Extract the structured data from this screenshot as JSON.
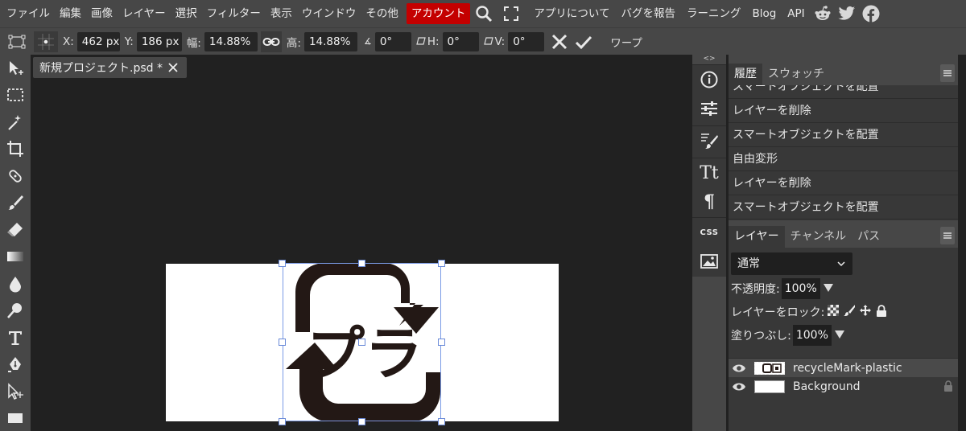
{
  "menubar": {
    "items": [
      "ファイル",
      "編集",
      "画像",
      "レイヤー",
      "選択",
      "フィルター",
      "表示",
      "ウインドウ",
      "その他"
    ],
    "account": "アカウント",
    "right_items": [
      "アプリについて",
      "バグを報告",
      "ラーニング",
      "Blog",
      "API"
    ],
    "icons": [
      "search-icon",
      "fullscreen-icon",
      "reddit-icon",
      "twitter-icon",
      "facebook-icon"
    ],
    "account_color": "#c40000"
  },
  "options": {
    "x_label": "X:",
    "x_value": "462 px",
    "y_label": "Y:",
    "y_value": "186 px",
    "w_label": "幅:",
    "w_value": "14.88%",
    "h_label": "高:",
    "h_value": "14.88%",
    "angle_label": "∡",
    "angle_value": "0°",
    "skewh_label": "H:",
    "skewh_value": "0°",
    "skewv_label": "V:",
    "skewv_value": "0°",
    "warp_label": "ワープ"
  },
  "document": {
    "tab_title": "新規プロジェクト.psd *"
  },
  "artwork": {
    "text": "プラ"
  },
  "history": {
    "tabs": [
      "履歴",
      "スウォッチ"
    ],
    "items": [
      "スマートオフジェクトを配置",
      "レイヤーを削除",
      "スマートオブジェクトを配置",
      "自由変形",
      "レイヤーを削除",
      "スマートオブジェクトを配置"
    ]
  },
  "layers": {
    "tabs": [
      "レイヤー",
      "チャンネル",
      "パス"
    ],
    "blend_mode": "通常",
    "opacity_label": "不透明度:",
    "opacity_value": "100%",
    "lock_label": "レイヤーをロック:",
    "fill_label": "塗りつぶし:",
    "fill_value": "100%",
    "items": [
      {
        "name": "recycleMark-plastic",
        "selected": true
      },
      {
        "name": "Background",
        "locked": true
      }
    ]
  },
  "iconcol": {
    "collapse_left": "<>",
    "collapse_right": "><",
    "css_label": "CSS",
    "text_glyph": "Tt",
    "para_glyph": "¶"
  }
}
